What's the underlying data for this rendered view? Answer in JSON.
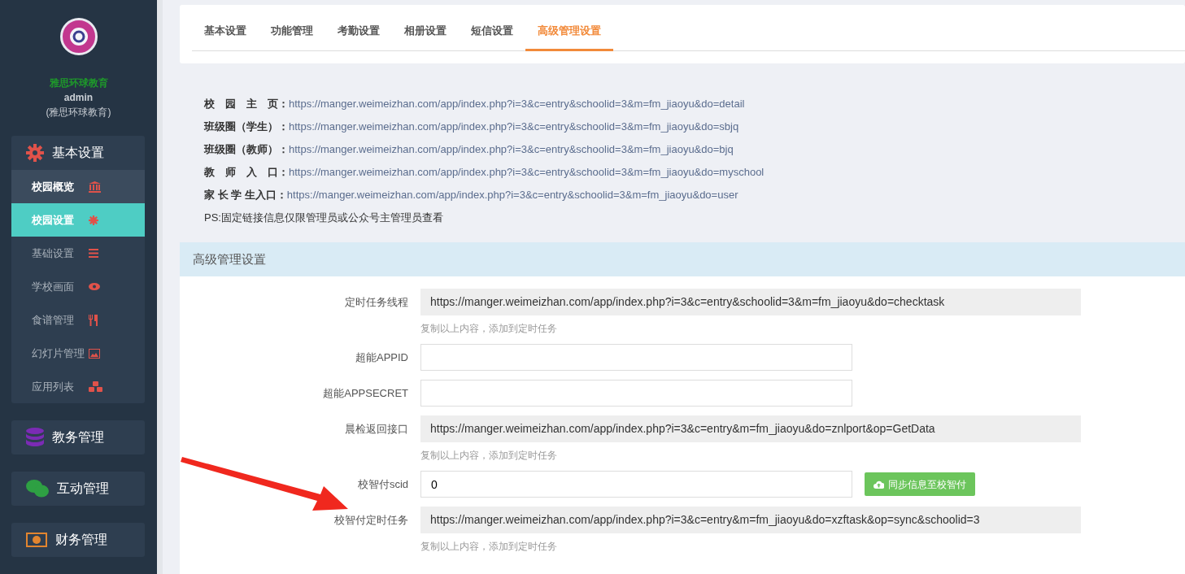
{
  "sidebar": {
    "school_name": "雅思环球教育",
    "user": "admin",
    "org": "(雅思环球教育)",
    "groups": [
      {
        "kind": "settings",
        "label": "基本设置",
        "items": [
          {
            "kind": "bank",
            "label": "校园概览",
            "selected": false,
            "hovered": true
          },
          {
            "kind": "gear",
            "label": "校园设置",
            "selected": true,
            "hovered": false
          },
          {
            "kind": "bars",
            "label": "基础设置",
            "selected": false,
            "hovered": false
          },
          {
            "kind": "eye",
            "label": "学校画面",
            "selected": false,
            "hovered": false
          },
          {
            "kind": "cutlery",
            "label": "食谱管理",
            "selected": false,
            "hovered": false
          },
          {
            "kind": "image",
            "label": "幻灯片管理",
            "selected": false,
            "hovered": false
          },
          {
            "kind": "cubes",
            "label": "应用列表",
            "selected": false,
            "hovered": false
          }
        ]
      },
      {
        "kind": "database",
        "label": "教务管理"
      },
      {
        "kind": "chat",
        "label": "互动管理"
      },
      {
        "kind": "money",
        "label": "财务管理"
      }
    ]
  },
  "tabs": [
    {
      "label": "基本设置",
      "selected": false
    },
    {
      "label": "功能管理",
      "selected": false
    },
    {
      "label": "考勤设置",
      "selected": false
    },
    {
      "label": "相册设置",
      "selected": false
    },
    {
      "label": "短信设置",
      "selected": false
    },
    {
      "label": "高级管理设置",
      "selected": true
    }
  ],
  "links": [
    {
      "label": "校　园　主　页：",
      "url": "https://manger.weimeizhan.com/app/index.php?i=3&c=entry&schoolid=3&m=fm_jiaoyu&do=detail"
    },
    {
      "label": "班级圈（学生）：",
      "url": "https://manger.weimeizhan.com/app/index.php?i=3&c=entry&schoolid=3&m=fm_jiaoyu&do=sbjq"
    },
    {
      "label": "班级圈（教师）：",
      "url": "https://manger.weimeizhan.com/app/index.php?i=3&c=entry&schoolid=3&m=fm_jiaoyu&do=bjq"
    },
    {
      "label": "教　师　入　口：",
      "url": "https://manger.weimeizhan.com/app/index.php?i=3&c=entry&schoolid=3&m=fm_jiaoyu&do=myschool"
    },
    {
      "label": "家 长 学 生入口：",
      "url": "https://manger.weimeizhan.com/app/index.php?i=3&c=entry&schoolid=3&m=fm_jiaoyu&do=user"
    }
  ],
  "note": "PS:固定链接信息仅限管理员或公众号主管理员查看",
  "panel": {
    "title": "高级管理设置",
    "fields": [
      {
        "kind": "readonly",
        "label": "定时任务线程",
        "value": "https://manger.weimeizhan.com/app/index.php?i=3&c=entry&schoolid=3&m=fm_jiaoyu&do=checktask",
        "help": "复制以上内容，添加到定时任务"
      },
      {
        "kind": "input",
        "label": "超能APPID"
      },
      {
        "kind": "input",
        "label": "超能APPSECRET"
      },
      {
        "kind": "readonly",
        "label": "晨检返回接口",
        "value": "https://manger.weimeizhan.com/app/index.php?i=3&c=entry&m=fm_jiaoyu&do=znlport&op=GetData",
        "help": "复制以上内容，添加到定时任务"
      },
      {
        "kind": "input",
        "label": "校智付scid",
        "value": "0",
        "button": "同步信息至校智付"
      },
      {
        "kind": "readonly",
        "label": "校智付定时任务",
        "value": "https://manger.weimeizhan.com/app/index.php?i=3&c=entry&m=fm_jiaoyu&do=xzftask&op=sync&schoolid=3",
        "help": "复制以上内容，添加到定时任务"
      }
    ]
  }
}
